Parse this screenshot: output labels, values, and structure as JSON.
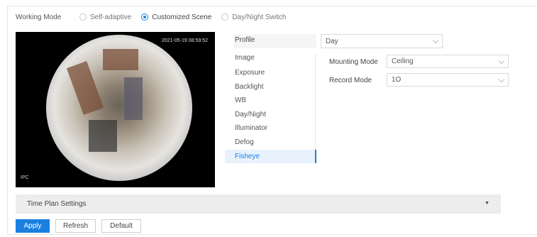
{
  "working_mode": {
    "label": "Working Mode",
    "options": [
      {
        "label": "Self-adaptive",
        "checked": false
      },
      {
        "label": "Customized Scene",
        "checked": true
      },
      {
        "label": "Day/Night Switch",
        "checked": false
      }
    ]
  },
  "preview": {
    "timestamp": "2021-05-19 08:59:52",
    "channel": "IPC"
  },
  "profile": {
    "label": "Profile",
    "value": "Day"
  },
  "menu": {
    "items": [
      "Image",
      "Exposure",
      "Backlight",
      "WB",
      "Day/Night",
      "Illuminator",
      "Defog",
      "Fisheye"
    ],
    "active": "Fisheye"
  },
  "fisheye_settings": {
    "mounting_mode_label": "Mounting Mode",
    "mounting_mode_value": "Ceiling",
    "record_mode_label": "Record Mode",
    "record_mode_value": "1O"
  },
  "time_plan": {
    "label": "Time Plan Settings"
  },
  "buttons": {
    "apply": "Apply",
    "refresh": "Refresh",
    "default": "Default"
  },
  "colors": {
    "accent": "#1a7fe0",
    "active_menu_bg": "#e8f2fd",
    "panel_bg": "#ededed"
  }
}
